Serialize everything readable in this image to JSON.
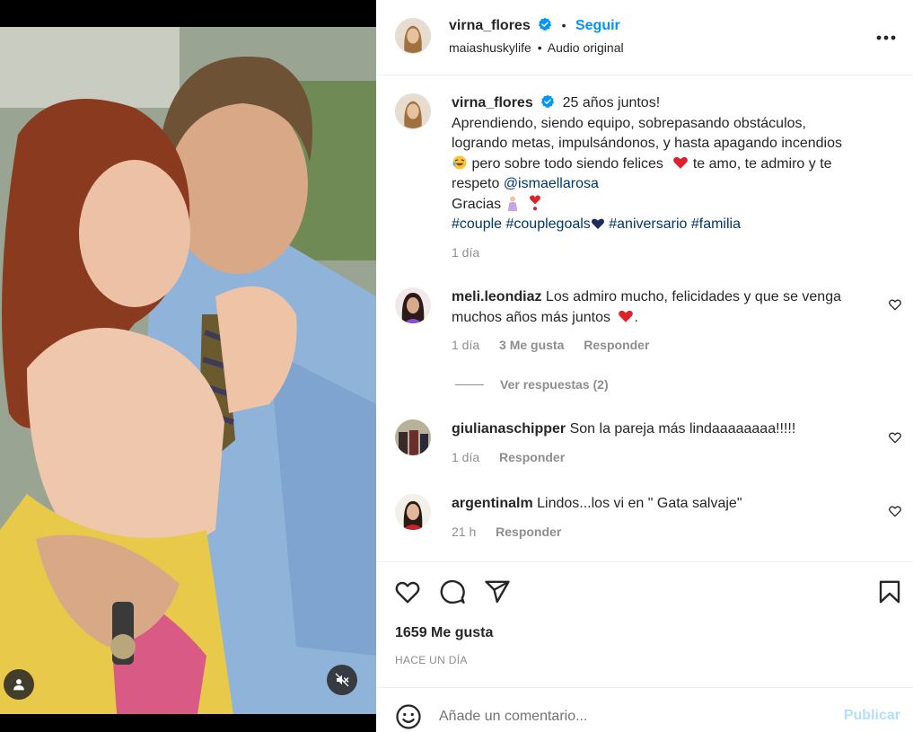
{
  "post": {
    "author": "virna_flores",
    "follow_label": "Seguir",
    "separator": "•",
    "subline_account": "maiashuskylife",
    "subline_audio": "Audio original"
  },
  "caption": {
    "author": "virna_flores",
    "line1": "25 años juntos!",
    "line2": "Aprendiendo, siendo equipo, sobrepasando obstáculos,",
    "line3": "logrando metas, impulsándonos, y hasta apagando incendios",
    "line4a": "pero sobre todo siendo felices",
    "line4b": " te amo, te admiro y te",
    "line5a": "respeto ",
    "mention": "@ismaellarosa",
    "line6": "Gracias ",
    "tags": [
      "#couple",
      "#couplegoals",
      "#aniversario",
      "#familia"
    ],
    "time": "1 día"
  },
  "comments": [
    {
      "user": "meli.leondiaz",
      "text": "Los admiro mucho, felicidades y que se venga",
      "text2": "muchos años más juntos",
      "text2_tail": ".",
      "time": "1 día",
      "likes": "3 Me gusta",
      "reply": "Responder"
    },
    {
      "user": "giulianaschipper",
      "text": "Son la pareja más lindaaaaaaaa!!!!!",
      "time": "1 día",
      "reply": "Responder"
    },
    {
      "user": "argentinalm",
      "text": "Lindos...los vi en \" Gata salvaje\"",
      "time": "21 h",
      "reply": "Responder"
    }
  ],
  "view_replies": "Ver respuestas (2)",
  "likes_count": "1659 Me gusta",
  "posted_ago": "HACE UN DÍA",
  "comment_input": {
    "placeholder": "Añade un comentario...",
    "publish_label": "Publicar"
  },
  "colors": {
    "accent": "#0095f6",
    "link": "#00376b",
    "muted": "#8e8e8e",
    "heart": "#ed4956",
    "publish_disabled": "#b2dffc"
  },
  "icons": [
    "verified-badge-icon",
    "more-options-icon",
    "heart-icon",
    "comment-icon",
    "share-icon",
    "bookmark-icon",
    "emoji-icon",
    "user-tag-icon",
    "mute-icon"
  ]
}
